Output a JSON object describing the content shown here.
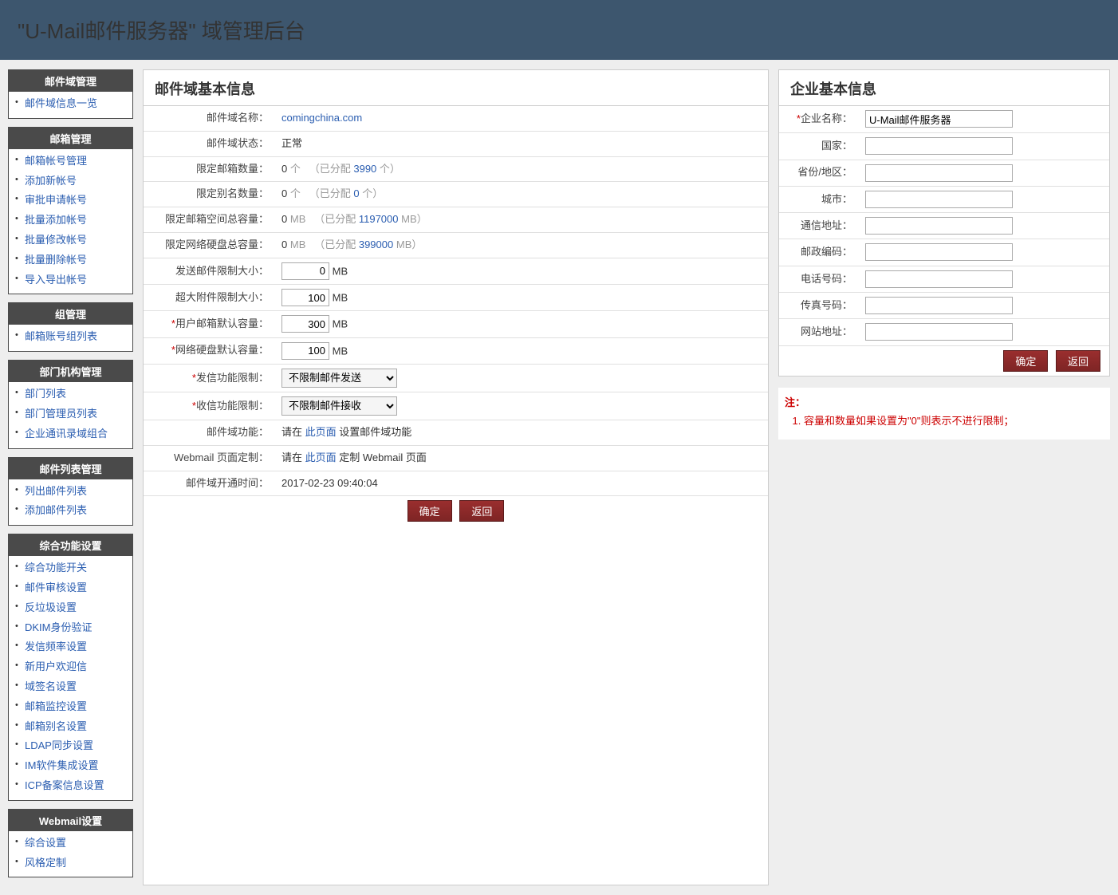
{
  "header": {
    "title": "\"U-Mail邮件服务器\" 域管理后台"
  },
  "sidebar": [
    {
      "header": "邮件域管理",
      "items": [
        "邮件域信息一览"
      ]
    },
    {
      "header": "邮箱管理",
      "items": [
        "邮箱帐号管理",
        "添加新帐号",
        "审批申请帐号",
        "批量添加帐号",
        "批量修改帐号",
        "批量删除帐号",
        "导入导出帐号"
      ]
    },
    {
      "header": "组管理",
      "items": [
        "邮箱账号组列表"
      ]
    },
    {
      "header": "部门机构管理",
      "items": [
        "部门列表",
        "部门管理员列表",
        "企业通讯录域组合"
      ]
    },
    {
      "header": "邮件列表管理",
      "items": [
        "列出邮件列表",
        "添加邮件列表"
      ]
    },
    {
      "header": "综合功能设置",
      "items": [
        "综合功能开关",
        "邮件审核设置",
        "反垃圾设置",
        "DKIM身份验证",
        "发信频率设置",
        "新用户欢迎信",
        "域签名设置",
        "邮箱监控设置",
        "邮箱别名设置",
        "LDAP同步设置",
        "IM软件集成设置",
        "ICP备案信息设置"
      ]
    },
    {
      "header": "Webmail设置",
      "items": [
        "综合设置",
        "风格定制"
      ]
    }
  ],
  "domainPanel": {
    "title": "邮件域基本信息",
    "domainName": {
      "label": "邮件域名称：",
      "value": "comingchina.com"
    },
    "status": {
      "label": "邮件域状态：",
      "value": "正常"
    },
    "mailboxLimit": {
      "label": "限定邮箱数量：",
      "count": "0",
      "countUnit": "个",
      "allocPrefix": "（已分配",
      "alloc": "3990",
      "allocUnit": "个）"
    },
    "aliasLimit": {
      "label": "限定别名数量：",
      "count": "0",
      "countUnit": "个",
      "allocPrefix": "（已分配",
      "alloc": "0",
      "allocUnit": "个）"
    },
    "spaceLimit": {
      "label": "限定邮箱空间总容量：",
      "count": "0",
      "unit": "MB",
      "allocPrefix": "（已分配",
      "alloc": "1197000",
      "allocUnit": "MB）"
    },
    "diskLimit": {
      "label": "限定网络硬盘总容量：",
      "count": "0",
      "unit": "MB",
      "allocPrefix": "（已分配",
      "alloc": "399000",
      "allocUnit": "MB）"
    },
    "sendSize": {
      "label": "发送邮件限制大小：",
      "value": "0",
      "unit": "MB"
    },
    "attachSize": {
      "label": "超大附件限制大小：",
      "value": "100",
      "unit": "MB"
    },
    "defaultMailbox": {
      "label": "用户邮箱默认容量：",
      "value": "300",
      "unit": "MB"
    },
    "defaultDisk": {
      "label": "网络硬盘默认容量：",
      "value": "100",
      "unit": "MB"
    },
    "sendLimit": {
      "label": "发信功能限制：",
      "value": "不限制邮件发送"
    },
    "recvLimit": {
      "label": "收信功能限制：",
      "value": "不限制邮件接收"
    },
    "domainFunc": {
      "label": "邮件域功能：",
      "prefix": "请在",
      "link": "此页面",
      "suffix": "设置邮件域功能"
    },
    "webmail": {
      "label": "Webmail 页面定制：",
      "prefix": "请在",
      "link": "此页面",
      "suffix": "定制 Webmail 页面"
    },
    "openTime": {
      "label": "邮件域开通时间：",
      "value": "2017-02-23 09:40:04"
    },
    "btnOk": "确定",
    "btnBack": "返回"
  },
  "companyPanel": {
    "title": "企业基本信息",
    "fields": {
      "name": {
        "label": "企业名称：",
        "value": "U-Mail邮件服务器",
        "required": true
      },
      "country": {
        "label": "国家：",
        "value": ""
      },
      "province": {
        "label": "省份/地区：",
        "value": ""
      },
      "city": {
        "label": "城市：",
        "value": ""
      },
      "address": {
        "label": "通信地址：",
        "value": ""
      },
      "postcode": {
        "label": "邮政编码：",
        "value": ""
      },
      "phone": {
        "label": "电话号码：",
        "value": ""
      },
      "fax": {
        "label": "传真号码：",
        "value": ""
      },
      "website": {
        "label": "网站地址：",
        "value": ""
      }
    },
    "btnOk": "确定",
    "btnBack": "返回"
  },
  "note": {
    "title": "注：",
    "items": [
      "容量和数量如果设置为\"0\"则表示不进行限制；"
    ]
  }
}
